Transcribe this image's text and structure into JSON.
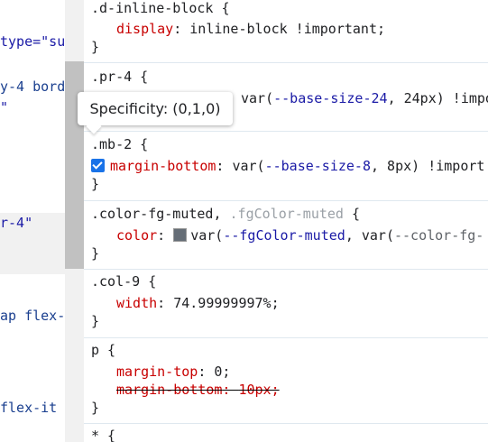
{
  "left_panel": {
    "fragments": [
      {
        "text": "type=\"su",
        "cls": "attr-string"
      },
      {
        "text": "y-4 bord",
        "cls": "attr-blue"
      },
      {
        "text": "\"",
        "cls": "attr-string"
      },
      {
        "text": "r-4\"",
        "cls": "attr-string"
      },
      {
        "text": "ap flex-",
        "cls": "attr-blue"
      },
      {
        "text": " flex-it",
        "cls": "attr-blue"
      }
    ]
  },
  "tooltip": {
    "text": "Specificity: (0,1,0)"
  },
  "rules": {
    "r1": {
      "selector": ".d-inline-block {",
      "prop": "display",
      "value": "inline-block !important;",
      "close": "}"
    },
    "r2": {
      "selector": ".pr-4 {",
      "value_prefix": "var(",
      "varname": "--base-size-24",
      "value_suffix": ", 24px) !impo",
      "close": "}"
    },
    "r3": {
      "selector": ".mb-2 {",
      "prop": "margin-bottom",
      "value_prefix": "var(",
      "varname": "--base-size-8",
      "value_suffix": ", 8px) !import",
      "close": "}"
    },
    "r4": {
      "selector_main": ".color-fg-muted,",
      "selector_inh": " .fgColor-muted",
      "selector_end": " {",
      "prop": "color",
      "swatch_color": "#656d76",
      "value_prefix": "var(",
      "varname": "--fgColor-muted",
      "value_mid": ", var(",
      "varname2": "--color-fg-",
      "close": "}"
    },
    "r5": {
      "selector": ".col-9 {",
      "prop": "width",
      "value": "74.99999997%;",
      "close": "}"
    },
    "r6": {
      "selector": "p {",
      "prop1": "margin-top",
      "value1": "0;",
      "prop2": "margin-bottom",
      "value2": "10px;",
      "close": "}"
    },
    "r7": {
      "selector": "* {"
    }
  }
}
